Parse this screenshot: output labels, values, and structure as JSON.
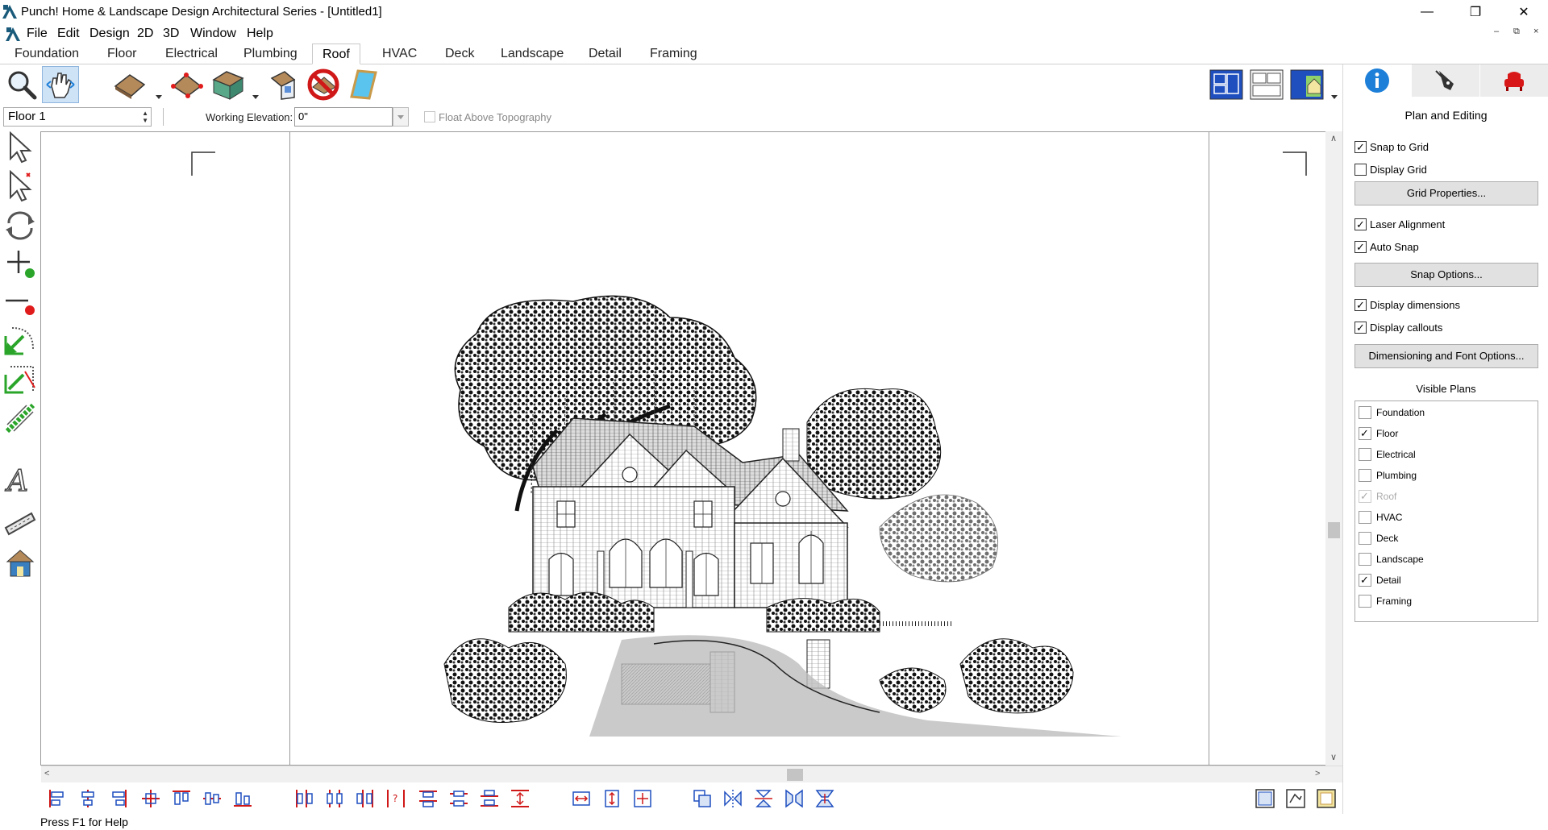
{
  "window": {
    "title": "Punch! Home & Landscape Design Architectural Series - [Untitled1]",
    "minimize": "—",
    "restore": "❐",
    "close": "✕"
  },
  "menu": [
    "File",
    "Edit",
    "Design",
    "2D",
    "3D",
    "Window",
    "Help"
  ],
  "mdi_controls": [
    "–",
    "⧉",
    "×"
  ],
  "tabs": [
    "Foundation",
    "Floor",
    "Electrical",
    "Plumbing",
    "Roof",
    "HVAC",
    "Deck",
    "Landscape",
    "Detail",
    "Framing"
  ],
  "active_tab": "Roof",
  "options": {
    "floor_value": "Floor 1",
    "working_elevation_label": "Working Elevation:",
    "working_elevation_value": "0\"",
    "float_label": "Float Above Topography"
  },
  "status": {
    "text": "Press F1 for Help"
  },
  "right_panel": {
    "heading": "Plan and Editing",
    "snap_to_grid": "Snap to Grid",
    "display_grid": "Display Grid",
    "grid_properties": "Grid Properties...",
    "laser_alignment": "Laser Alignment",
    "auto_snap": "Auto Snap",
    "snap_options": "Snap Options...",
    "display_dimensions": "Display dimensions",
    "display_callouts": "Display callouts",
    "dim_font_options": "Dimensioning and Font Options...",
    "visible_plans_heading": "Visible Plans",
    "visible_plans": [
      {
        "label": "Foundation",
        "checked": false,
        "disabled": false
      },
      {
        "label": "Floor",
        "checked": true,
        "disabled": false
      },
      {
        "label": "Electrical",
        "checked": false,
        "disabled": false
      },
      {
        "label": "Plumbing",
        "checked": false,
        "disabled": false
      },
      {
        "label": "Roof",
        "checked": true,
        "disabled": true
      },
      {
        "label": "HVAC",
        "checked": false,
        "disabled": false
      },
      {
        "label": "Deck",
        "checked": false,
        "disabled": false
      },
      {
        "label": "Landscape",
        "checked": false,
        "disabled": false
      },
      {
        "label": "Detail",
        "checked": true,
        "disabled": false
      },
      {
        "label": "Framing",
        "checked": false,
        "disabled": false
      }
    ]
  },
  "colors": {
    "accent_blue": "#1e7fd8",
    "roof_brown": "#b58a5a",
    "tool_green": "#2aa52a",
    "tool_red": "#e01b1b"
  }
}
